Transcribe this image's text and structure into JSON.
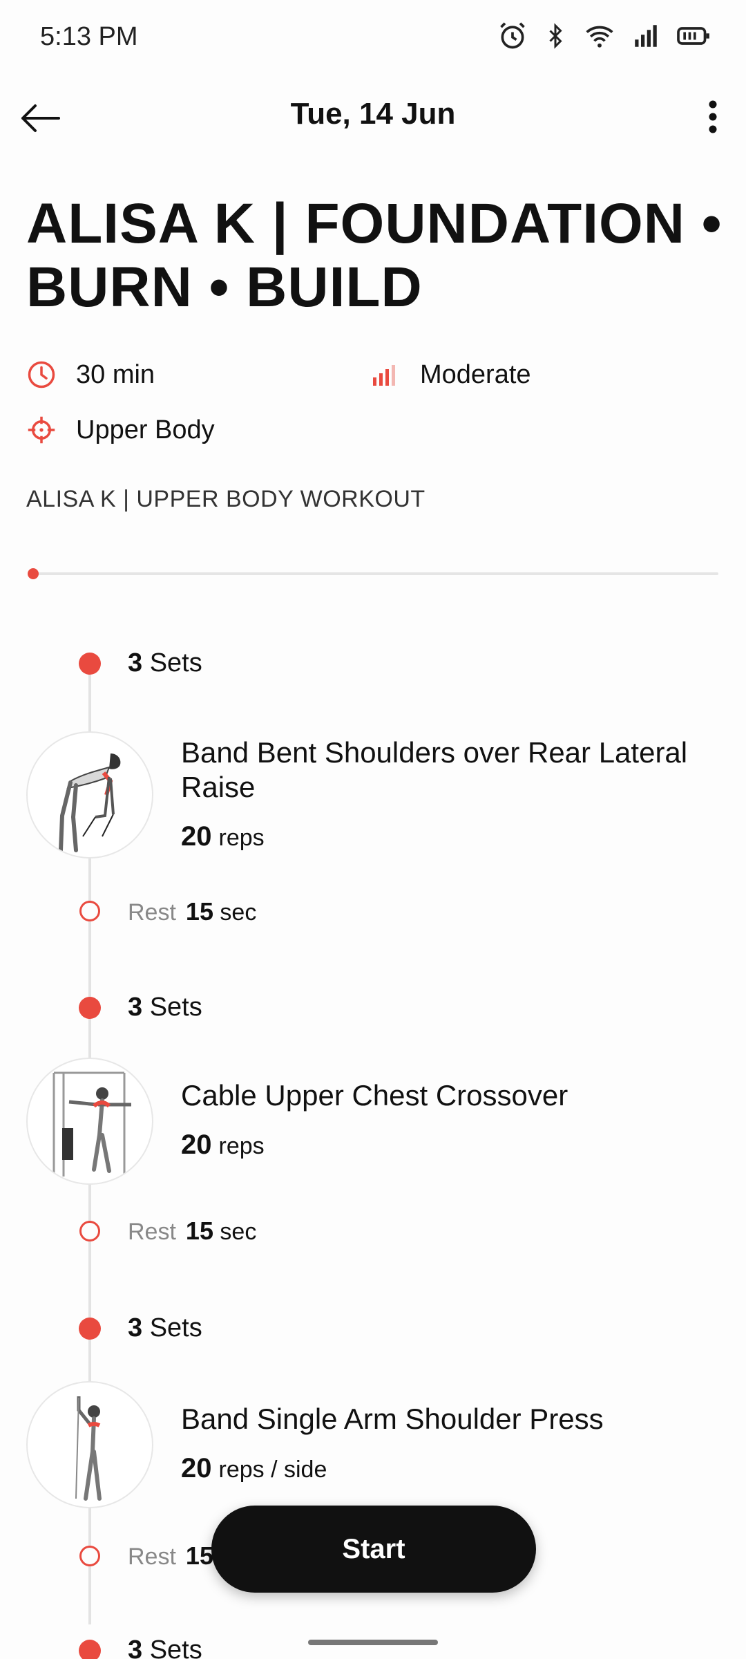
{
  "status_bar": {
    "time": "5:13 PM"
  },
  "header": {
    "date": "Tue, 14 Jun"
  },
  "workout": {
    "title": "ALISA K | FOUNDATION • BURN • BUILD",
    "duration": "30 min",
    "level": "Moderate",
    "focus": "Upper Body",
    "subtitle": "ALISA K | UPPER BODY WORKOUT",
    "progress": 0.0
  },
  "exercises": [
    {
      "sets_num": "3",
      "sets_label": "Sets",
      "name": "Band Bent Shoulders over Rear Lateral Raise",
      "reps_num": "20",
      "reps_unit": "reps",
      "rest_label": "Rest",
      "rest_num": "15",
      "rest_unit": "sec"
    },
    {
      "sets_num": "3",
      "sets_label": "Sets",
      "name": "Cable Upper Chest Crossover",
      "reps_num": "20",
      "reps_unit": "reps",
      "rest_label": "Rest",
      "rest_num": "15",
      "rest_unit": "sec"
    },
    {
      "sets_num": "3",
      "sets_label": "Sets",
      "name": "Band Single Arm Shoulder Press",
      "reps_num": "20",
      "reps_unit": "reps / side",
      "rest_label": "Rest",
      "rest_num": "15",
      "rest_unit": "sec"
    },
    {
      "sets_num": "3",
      "sets_label": "Sets"
    }
  ],
  "start_button": {
    "label": "Start"
  },
  "colors": {
    "accent": "#e94a3f",
    "button": "#111111"
  }
}
